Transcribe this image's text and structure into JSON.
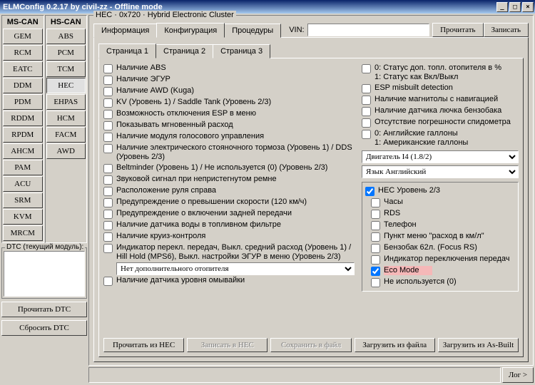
{
  "window": {
    "title": "ELMConfig 0.2.17 by civil-zz - Offline mode"
  },
  "bus": {
    "mscan_label": "MS-CAN",
    "hscan_label": "HS-CAN",
    "mscan": [
      "GEM",
      "RCM",
      "EATC",
      "DDM",
      "PDM",
      "RDDM",
      "RPDM",
      "AHCM",
      "PAM",
      "ACU",
      "SRM",
      "KVM",
      "MRCM"
    ],
    "hscan": [
      "ABS",
      "PCM",
      "TCM",
      "HEC",
      "EHPAS",
      "HCM",
      "FACM",
      "AWD"
    ]
  },
  "dtc": {
    "group_label": "DTC (текущий модуль):",
    "read": "Прочитать DTC",
    "reset": "Сбросить DTC"
  },
  "module": {
    "title": "HEC · 0x720 · Hybrid Electronic Cluster",
    "tabs": [
      "Информация",
      "Конфигурация",
      "Процедуры"
    ],
    "active_tab": 1,
    "vin_label": "VIN:",
    "read": "Прочитать",
    "write": "Записать"
  },
  "pages": {
    "tabs": [
      "Страница 1",
      "Страница 2",
      "Страница 3"
    ],
    "active": 0
  },
  "colA": [
    "Наличие ABS",
    "Наличие ЭГУР",
    "Наличие AWD (Kuga)",
    "KV (Уровень 1) / Saddle Tank (Уровень 2/3)",
    "Возможность отключения ESP в меню",
    "Показывать мгновенный расход",
    "Наличие модуля голосового управления",
    "Наличие электрического стояночного тормоза (Уровень 1) / DDS (Уровень 2/3)",
    "Beltminder (Уровень 1) / Не используется (0) (Уровень 2/3)",
    "Звуковой сигнал при непристегнутом ремне",
    "Расположение руля справа",
    "Предупреждение о превышении скорости (120 км/ч)",
    "Предупреждение о включении задней передачи",
    "Наличие датчика воды в топливном фильтре",
    "Наличие круиз-контроля",
    "Индикатор перекл. передач, Выкл. средний расход (Уровень 1) / Hill Hold (MPS6), Выкл. настройки ЭГУР в меню  (Уровень 2/3)",
    "",
    "Наличие датчика уровня омывайки"
  ],
  "colA_select": "Нет дополнительного отопителя",
  "colB_top": [
    "0: Статус доп. топл. отопителя в %\n1: Статус как Вкл/Выкл",
    "ESP misbuilt detection",
    "Наличие магнитолы с навигацией",
    "Наличие датчика лючка бензобака",
    "Отсутствие погрешности спидометра",
    "0: Английские галлоны\n1: Американские галлоны"
  ],
  "selects": {
    "engine": "Двигатель I4 (1.8/2)",
    "lang": "Язык Английский"
  },
  "subgroup": {
    "header": "HEC Уровень 2/3",
    "items": [
      "Часы",
      "RDS",
      "Телефон",
      "Пункт меню \"расход в км/л\"",
      "Бензобак 62л. (Focus RS)",
      "Индикатор переключения передач",
      "Eco Mode",
      "Не используется (0)"
    ]
  },
  "bottom": {
    "read_hec": "Прочитать из HEC",
    "write_hec": "Записать в HEC",
    "save_file": "Сохранить в файл",
    "load_file": "Загрузить из файла",
    "load_asbuilt": "Загрузить из As-Built"
  },
  "log_btn": "Лог >"
}
